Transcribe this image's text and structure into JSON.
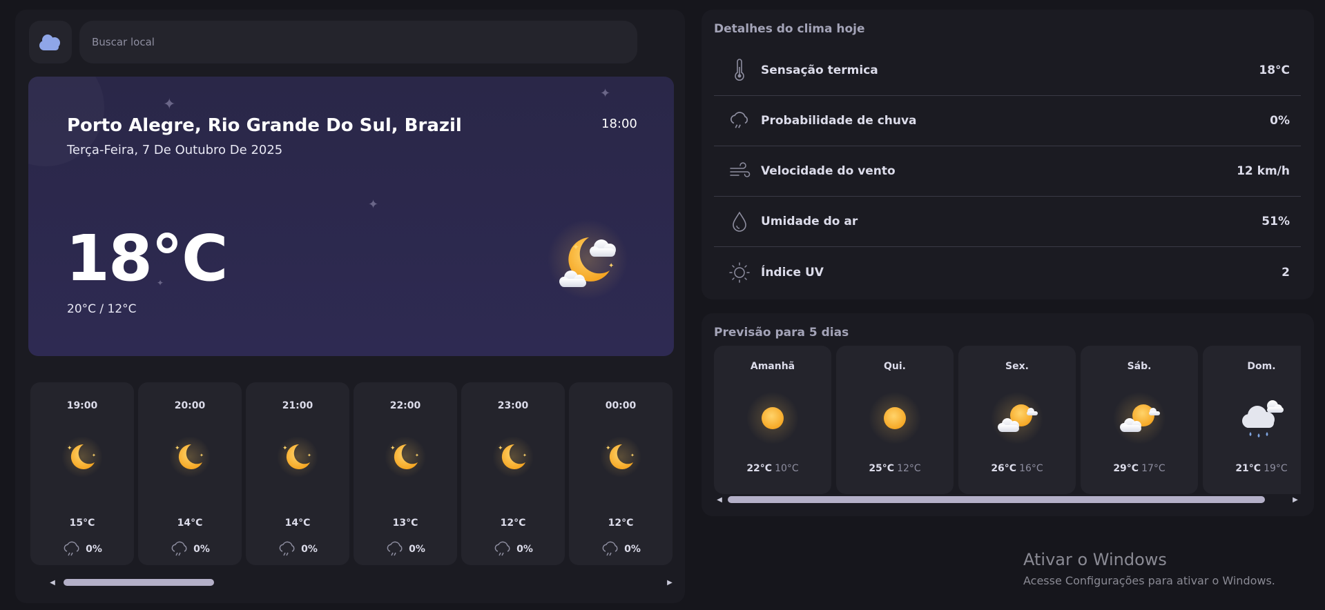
{
  "search": {
    "placeholder": "Buscar local"
  },
  "current": {
    "city": "Porto Alegre, Rio Grande Do Sul, Brazil",
    "date": "Terça-Feira, 7 De Outubro De 2025",
    "time": "18:00",
    "temperature": "18°C",
    "minmax": "20°C / 12°C",
    "icon": "moon-cloud-icon"
  },
  "hourly": [
    {
      "time": "19:00",
      "temp": "15°C",
      "rain": "0%",
      "icon": "moon-icon"
    },
    {
      "time": "20:00",
      "temp": "14°C",
      "rain": "0%",
      "icon": "moon-icon"
    },
    {
      "time": "21:00",
      "temp": "14°C",
      "rain": "0%",
      "icon": "moon-icon"
    },
    {
      "time": "22:00",
      "temp": "13°C",
      "rain": "0%",
      "icon": "moon-icon"
    },
    {
      "time": "23:00",
      "temp": "12°C",
      "rain": "0%",
      "icon": "moon-icon"
    },
    {
      "time": "00:00",
      "temp": "12°C",
      "rain": "0%",
      "icon": "moon-icon"
    }
  ],
  "details": {
    "title": "Detalhes do clima hoje",
    "rows": [
      {
        "label": "Sensação termica",
        "value": "18°C",
        "icon": "thermometer-icon"
      },
      {
        "label": "Probabilidade de chuva",
        "value": "0%",
        "icon": "rain-cloud-icon"
      },
      {
        "label": "Velocidade do vento",
        "value": "12 km/h",
        "icon": "wind-icon"
      },
      {
        "label": "Umidade do ar",
        "value": "51%",
        "icon": "droplet-icon"
      },
      {
        "label": "Índice UV",
        "value": "2",
        "icon": "sun-outline-icon"
      }
    ]
  },
  "forecast": {
    "title": "Previsão para 5 dias",
    "days": [
      {
        "day": "Amanhã",
        "max": "22°C",
        "min": "10°C",
        "icon": "sun-icon"
      },
      {
        "day": "Qui.",
        "max": "25°C",
        "min": "12°C",
        "icon": "sun-icon"
      },
      {
        "day": "Sex.",
        "max": "26°C",
        "min": "16°C",
        "icon": "sun-cloud-icon"
      },
      {
        "day": "Sáb.",
        "max": "29°C",
        "min": "17°C",
        "icon": "sun-cloud-icon"
      },
      {
        "day": "Dom.",
        "max": "21°C",
        "min": "19°C",
        "icon": "rain-clouds-icon"
      }
    ]
  },
  "windows": {
    "title": "Ativar o Windows",
    "subtitle": "Acesse Configurações para ativar o Windows."
  }
}
